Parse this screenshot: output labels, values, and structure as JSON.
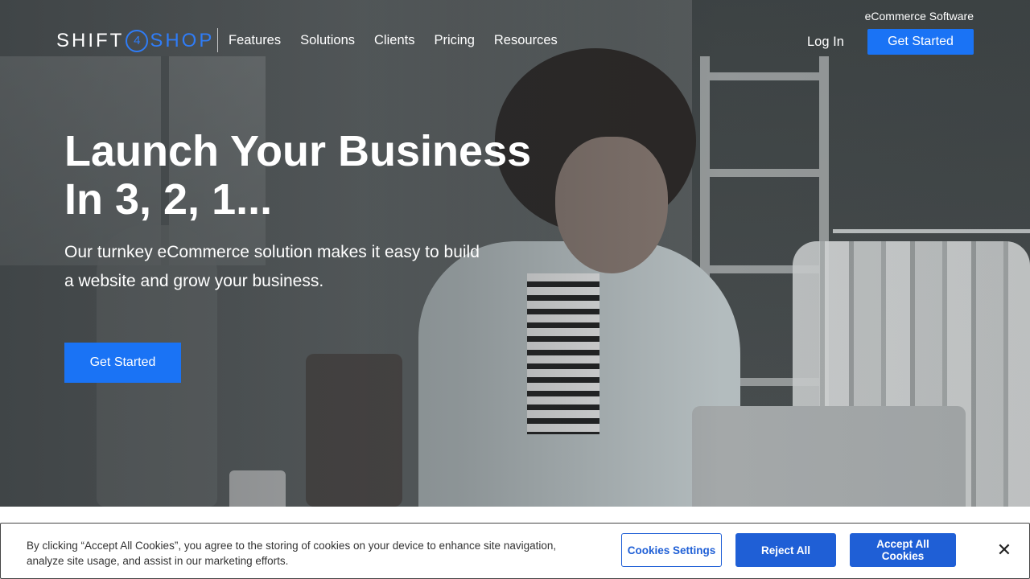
{
  "header": {
    "logo": {
      "part1": "SHIFT",
      "four": "4",
      "part2": "SHOP"
    },
    "tagline": "eCommerce Software",
    "nav": [
      "Features",
      "Solutions",
      "Clients",
      "Pricing",
      "Resources"
    ],
    "login_label": "Log In",
    "cta_label": "Get Started"
  },
  "hero": {
    "title_line1": "Launch Your Business",
    "title_line2": "In 3, 2, 1...",
    "subtitle": "Our turnkey eCommerce solution makes it easy to build a website and grow your business.",
    "cta_label": "Get Started"
  },
  "cookie_banner": {
    "text": "By clicking “Accept All Cookies”, you agree to the storing of cookies on your device to enhance site navigation, analyze site usage, and assist in our marketing efforts.",
    "settings_label": "Cookies Settings",
    "reject_label": "Reject All",
    "accept_label": "Accept All Cookies",
    "close_glyph": "✕"
  },
  "colors": {
    "accent": "#1a73f5",
    "cookie_accent": "#1f5fd6"
  }
}
